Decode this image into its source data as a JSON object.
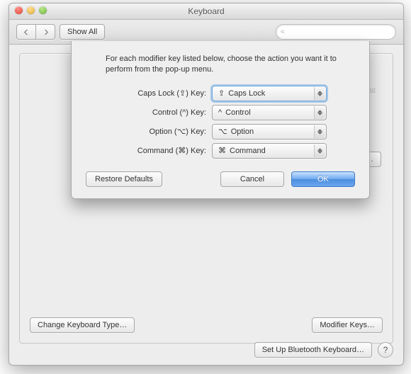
{
  "window": {
    "title": "Keyboard",
    "show_all": "Show All",
    "search_placeholder": ""
  },
  "background": {
    "key_repeat": "Repeat",
    "input_sources": "Input Sources…",
    "change_keyboard_type": "Change Keyboard Type…",
    "modifier_keys": "Modifier Keys…",
    "setup_bluetooth": "Set Up Bluetooth Keyboard…"
  },
  "sheet": {
    "instruction": "For each modifier key listed below, choose the action you want it to perform from the pop-up menu.",
    "rows": [
      {
        "label": "Caps Lock (⇪) Key:",
        "symbol": "⇪",
        "value": "Caps Lock",
        "focused": true
      },
      {
        "label": "Control (^) Key:",
        "symbol": "^",
        "value": "Control",
        "focused": false
      },
      {
        "label": "Option (⌥) Key:",
        "symbol": "⌥",
        "value": "Option",
        "focused": false
      },
      {
        "label": "Command (⌘) Key:",
        "symbol": "⌘",
        "value": "Command",
        "focused": false
      }
    ],
    "restore": "Restore Defaults",
    "cancel": "Cancel",
    "ok": "OK"
  }
}
